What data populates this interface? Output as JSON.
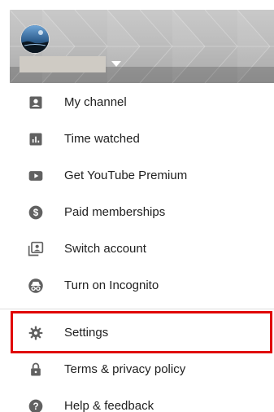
{
  "header": {
    "avatar_icon": "profile-photo",
    "caret_icon": "triangle-down-icon",
    "account_name_redacted": true
  },
  "menu": {
    "items": [
      {
        "label": "My channel",
        "icon": "account-box-icon"
      },
      {
        "label": "Time watched",
        "icon": "bar-chart-icon"
      },
      {
        "label": "Get YouTube Premium",
        "icon": "youtube-play-icon"
      },
      {
        "label": "Paid memberships",
        "icon": "dollar-circle-icon"
      },
      {
        "label": "Switch account",
        "icon": "switch-account-icon"
      },
      {
        "label": "Turn on Incognito",
        "icon": "incognito-icon"
      },
      {
        "label": "Settings",
        "icon": "gear-icon"
      },
      {
        "label": "Terms & privacy policy",
        "icon": "lock-icon"
      },
      {
        "label": "Help & feedback",
        "icon": "help-circle-icon"
      }
    ]
  },
  "colors": {
    "icon": "#616161",
    "text": "#212121",
    "highlight": "#e00000",
    "divider": "#e0e0e0"
  }
}
